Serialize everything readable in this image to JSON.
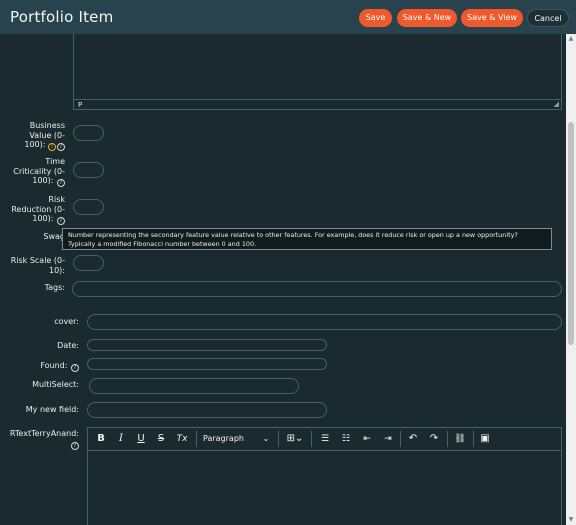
{
  "header": {
    "title": "Portfolio Item",
    "buttons": {
      "save": "Save",
      "save_new": "Save & New",
      "save_view": "Save & View",
      "cancel": "Cancel"
    }
  },
  "top_editor": {
    "status_path": "P"
  },
  "fields": {
    "business_value": {
      "label_lines": [
        "Business",
        "Value (0-",
        "100):"
      ]
    },
    "time_criticality": {
      "label_lines": [
        "Time",
        "Criticality (0-",
        "100):"
      ]
    },
    "risk_reduction": {
      "label_lines": [
        "Risk",
        "Reduction (0-",
        "100):"
      ]
    },
    "swag": {
      "label": "Swag"
    },
    "risk_scale": {
      "label_lines": [
        "Risk Scale (0-",
        "10):"
      ]
    },
    "tags": {
      "label": "Tags:"
    },
    "cover": {
      "label": "cover:"
    },
    "date": {
      "label": "Date:"
    },
    "found": {
      "label": "Found:"
    },
    "multiselect": {
      "label": "MultiSelect:"
    },
    "my_new_field": {
      "label": "My new field:"
    },
    "rtext": {
      "label": "RTextTerryAnand:"
    }
  },
  "tooltip": {
    "text": "Number representing the secondary feature value relative to other features. For example, does it reduce risk or open up a new opportunity? Typically a modified Fibonacci number between 0 and 100."
  },
  "rte_toolbar": {
    "bold": "B",
    "italic": "I",
    "underline": "U",
    "strikethrough": "S",
    "clear_format": "Tx",
    "block_format": "Paragraph"
  },
  "icons": {
    "help": "question-circle-icon",
    "warning": "warning-circle-icon"
  },
  "colors": {
    "header_bg": "#28434d",
    "page_bg": "#1b2a2f",
    "accent": "#f0592b",
    "warning": "#e0b12a"
  }
}
